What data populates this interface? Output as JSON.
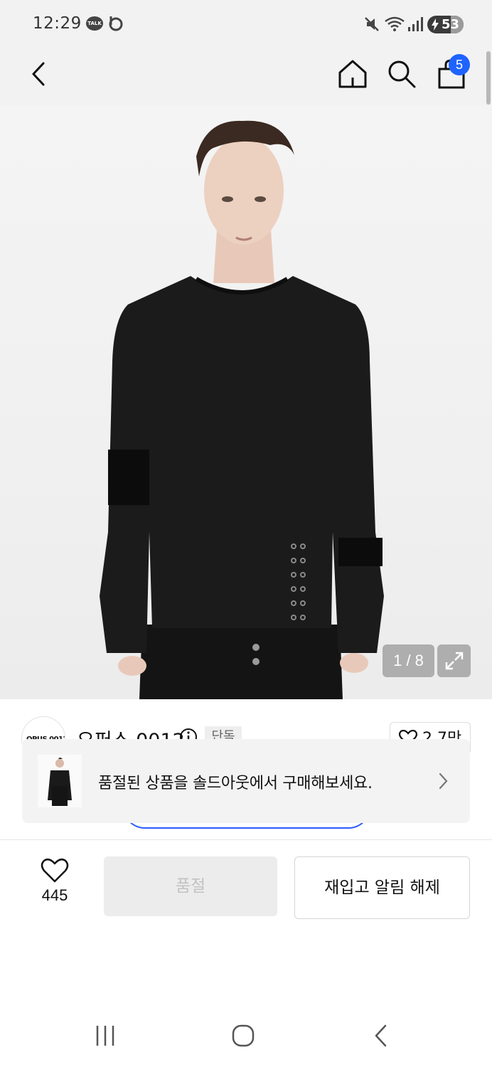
{
  "status_bar": {
    "time": "12:29",
    "talk_label": "TALK",
    "battery": "53"
  },
  "nav": {
    "cart_count": "5"
  },
  "gallery": {
    "counter": "1 / 8"
  },
  "brand": {
    "logo_text": "OPUS 0012",
    "name": "오퍼스 0012",
    "tag": "단독",
    "likes": "2.7만"
  },
  "soldout_banner": {
    "message": "품절된 상품을 솔드아웃에서 구매해보세요."
  },
  "bottom_bar": {
    "wish_count": "445",
    "soldout_label": "품절",
    "restock_label": "재입고 알림 해제"
  },
  "colors": {
    "accent_blue": "#1f63ff",
    "status_bg": "#f2f2f2"
  }
}
